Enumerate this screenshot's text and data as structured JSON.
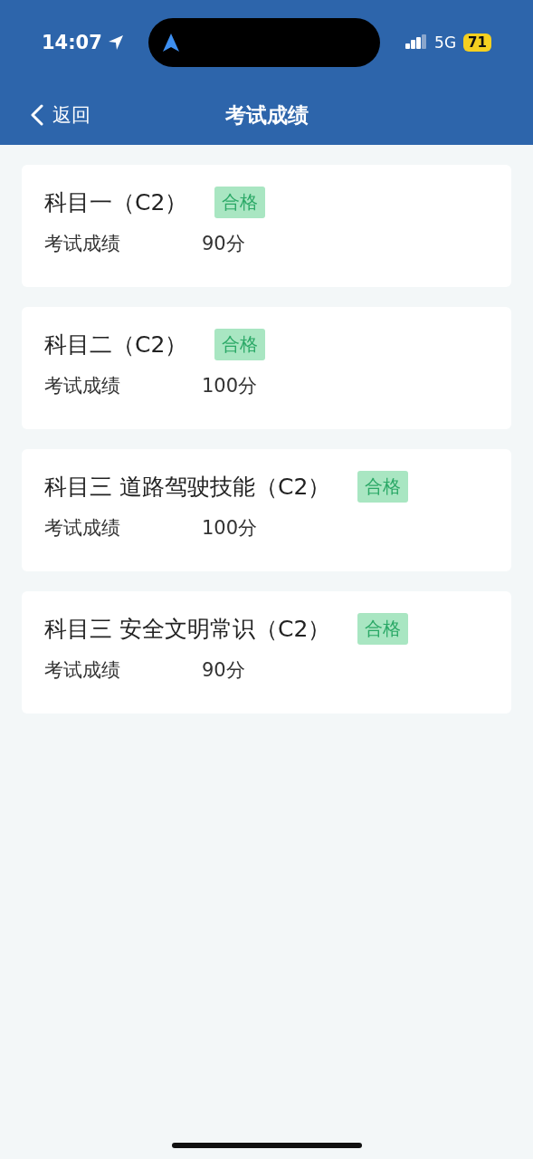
{
  "status_bar": {
    "time": "14:07",
    "network": "5G",
    "battery": "71"
  },
  "nav": {
    "back": "返回",
    "title": "考试成绩"
  },
  "results": [
    {
      "subject": "科目一（C2）",
      "result": "合格",
      "passed": true,
      "score_label": "考试成绩",
      "score": "90分"
    },
    {
      "subject": "科目二（C2）",
      "result": "合格",
      "passed": true,
      "score_label": "考试成绩",
      "score": "100分"
    },
    {
      "subject": "科目三 道路驾驶技能（C2）",
      "result": "合格",
      "passed": true,
      "score_label": "考试成绩",
      "score": "100分"
    },
    {
      "subject": "科目三 安全文明常识（C2）",
      "result": "合格",
      "passed": true,
      "score_label": "考试成绩",
      "score": "90分"
    }
  ]
}
